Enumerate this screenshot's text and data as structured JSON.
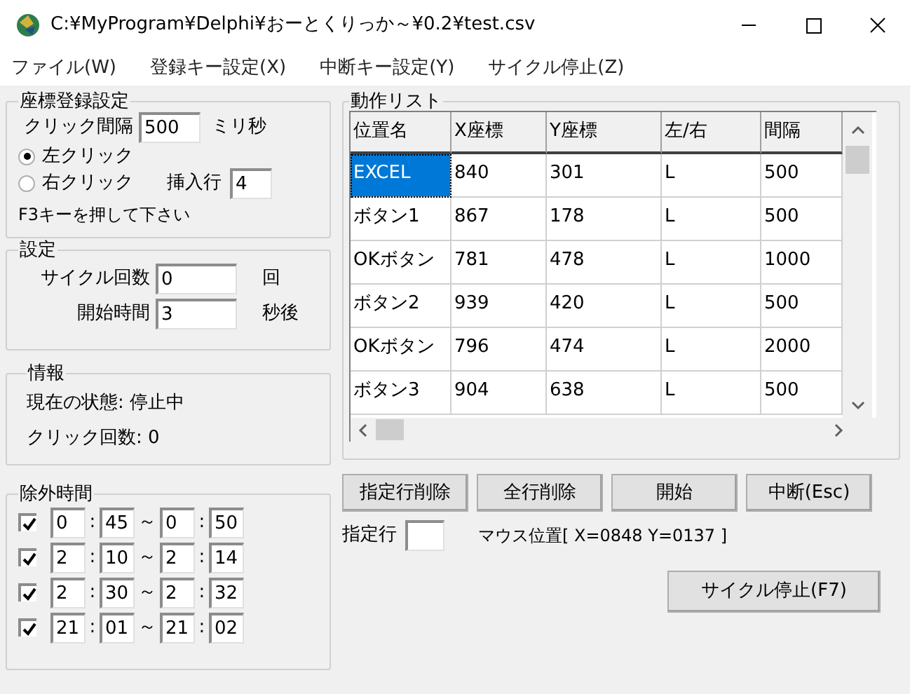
{
  "window": {
    "title": "C:¥MyProgram¥Delphi¥おーとくりっか～¥0.2¥test.csv"
  },
  "menu": [
    "ファイル(W)",
    "登録キー設定(X)",
    "中断キー設定(Y)",
    "サイクル停止(Z)"
  ],
  "coord_settings": {
    "title": "座標登録設定",
    "interval_label": "クリック間隔",
    "interval_value": "500",
    "interval_unit": "ミリ秒",
    "click_options": [
      {
        "label": "左クリック",
        "selected": true
      },
      {
        "label": "右クリック",
        "selected": false
      }
    ],
    "insert_row_label": "挿入行",
    "insert_row_value": "4",
    "hint": "F3キーを押して下さい"
  },
  "settings": {
    "title": "設定",
    "rows": [
      {
        "label": "サイクル回数",
        "value": "0",
        "unit": "回"
      },
      {
        "label": "開始時間",
        "value": "3",
        "unit": "秒後"
      }
    ]
  },
  "info": {
    "title": "情報",
    "lines": [
      "現在の状態: 停止中",
      "クリック回数: 0"
    ]
  },
  "exclusion": {
    "title": "除外時間",
    "rows": [
      {
        "checked": true,
        "from_h": "0",
        "colon_1": ":",
        "from_m": "45",
        "tilde": "～",
        "to_h": "0",
        "colon_2": ":",
        "to_m": "50"
      },
      {
        "checked": true,
        "from_h": "2",
        "colon_1": ":",
        "from_m": "10",
        "tilde": "～",
        "to_h": "2",
        "colon_2": ":",
        "to_m": "14"
      },
      {
        "checked": true,
        "from_h": "2",
        "colon_1": ":",
        "from_m": "30",
        "tilde": "～",
        "to_h": "2",
        "colon_2": ":",
        "to_m": "32"
      },
      {
        "checked": true,
        "from_h": "21",
        "colon_1": ":",
        "from_m": "01",
        "tilde": "～",
        "to_h": "21",
        "colon_2": ":",
        "to_m": "02"
      }
    ]
  },
  "action_list": {
    "title": "動作リスト",
    "columns": [
      "位置名",
      "X座標",
      "Y座標",
      "左/右",
      "間隔"
    ],
    "rows": [
      {
        "selected": true,
        "cells": [
          "EXCEL",
          "840",
          "301",
          "L",
          "500"
        ]
      },
      {
        "selected": false,
        "cells": [
          "ボタン1",
          "867",
          "178",
          "L",
          "500"
        ]
      },
      {
        "selected": false,
        "cells": [
          "OKボタン",
          "781",
          "478",
          "L",
          "1000"
        ]
      },
      {
        "selected": false,
        "cells": [
          "ボタン2",
          "939",
          "420",
          "L",
          "500"
        ]
      },
      {
        "selected": false,
        "cells": [
          "OKボタン",
          "796",
          "474",
          "L",
          "2000"
        ]
      },
      {
        "selected": false,
        "cells": [
          "ボタン3",
          "904",
          "638",
          "L",
          "500"
        ]
      }
    ]
  },
  "buttons": [
    "指定行削除",
    "全行削除",
    "開始",
    "中断(Esc)"
  ],
  "row_label": "指定行",
  "mouse_position": "マウス位置[ X=0848 Y=0137 ]",
  "cycle_stop_button": "サイクル停止(F7)"
}
